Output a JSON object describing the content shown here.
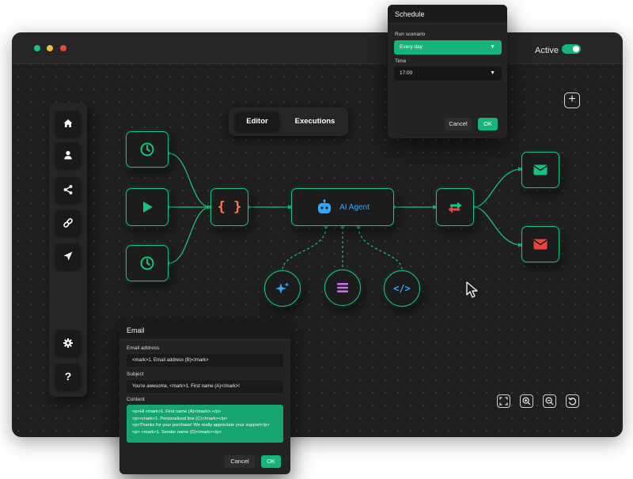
{
  "window": {
    "traffic_lights": [
      "#17c27e",
      "#e6c23a",
      "#e8443a"
    ],
    "status_label": "Active",
    "active_toggle": true
  },
  "colors": {
    "accent": "#17c27e",
    "ai_blue": "#2eaaff",
    "danger": "#e8443a",
    "code_orange": "#ff7a45",
    "purple": "#c86cf0"
  },
  "tabs": [
    {
      "label": "Editor",
      "selected": true
    },
    {
      "label": "Executions",
      "selected": false
    }
  ],
  "sidebar": {
    "items": [
      {
        "icon": "home-icon"
      },
      {
        "icon": "user-icon"
      },
      {
        "icon": "share-icon"
      },
      {
        "icon": "link-icon"
      },
      {
        "icon": "send-icon"
      }
    ],
    "bottom_items": [
      {
        "icon": "gear-icon"
      },
      {
        "icon": "help-icon",
        "glyph": "?"
      }
    ]
  },
  "workflow": {
    "nodes": [
      {
        "id": "trigger-clock-1",
        "icon": "clock-icon"
      },
      {
        "id": "trigger-play",
        "icon": "play-icon"
      },
      {
        "id": "trigger-clock-2",
        "icon": "clock-icon"
      },
      {
        "id": "code",
        "icon": "braces-icon",
        "glyph": "{ }"
      },
      {
        "id": "ai-agent",
        "icon": "robot-icon",
        "label": "AI Agent"
      },
      {
        "id": "router",
        "icon": "swap-arrows-icon"
      },
      {
        "id": "email-1",
        "icon": "mail-icon"
      },
      {
        "id": "email-2",
        "icon": "mail-icon"
      },
      {
        "id": "tool-sparkle",
        "icon": "sparkle-icon"
      },
      {
        "id": "tool-menu",
        "icon": "menu-icon"
      },
      {
        "id": "tool-code",
        "icon": "code-icon",
        "glyph": "</>"
      }
    ]
  },
  "schedule": {
    "title": "Schedule",
    "run_label": "Run scenario",
    "run_value": "Every day",
    "time_label": "Time",
    "time_value": "17:00",
    "cancel": "Cancel",
    "ok": "OK"
  },
  "email": {
    "title": "Email",
    "address_label": "Email address",
    "address_value": "<mark>1. Email address (B)</mark>",
    "subject_label": "Subject",
    "subject_value": "You're awesome, <mark>1. First name (A)</mark>!",
    "content_label": "Content",
    "content_lines": [
      "<p>Hi <mark>1. First name (A)</mark>,</p>",
      "<p><mark>1. Personalized line (C)</mark></p>",
      "<p>Thanks for your purchase! We really appreciate your support</p>",
      "<p>  <mark>1. Sender name (D)</mark></p>"
    ],
    "cancel": "Cancel",
    "ok": "OK"
  },
  "canvas_controls": [
    {
      "icon": "fit-screen-icon"
    },
    {
      "icon": "zoom-in-icon"
    },
    {
      "icon": "zoom-out-icon"
    },
    {
      "icon": "undo-icon"
    }
  ],
  "add_button": {
    "glyph": "+"
  }
}
